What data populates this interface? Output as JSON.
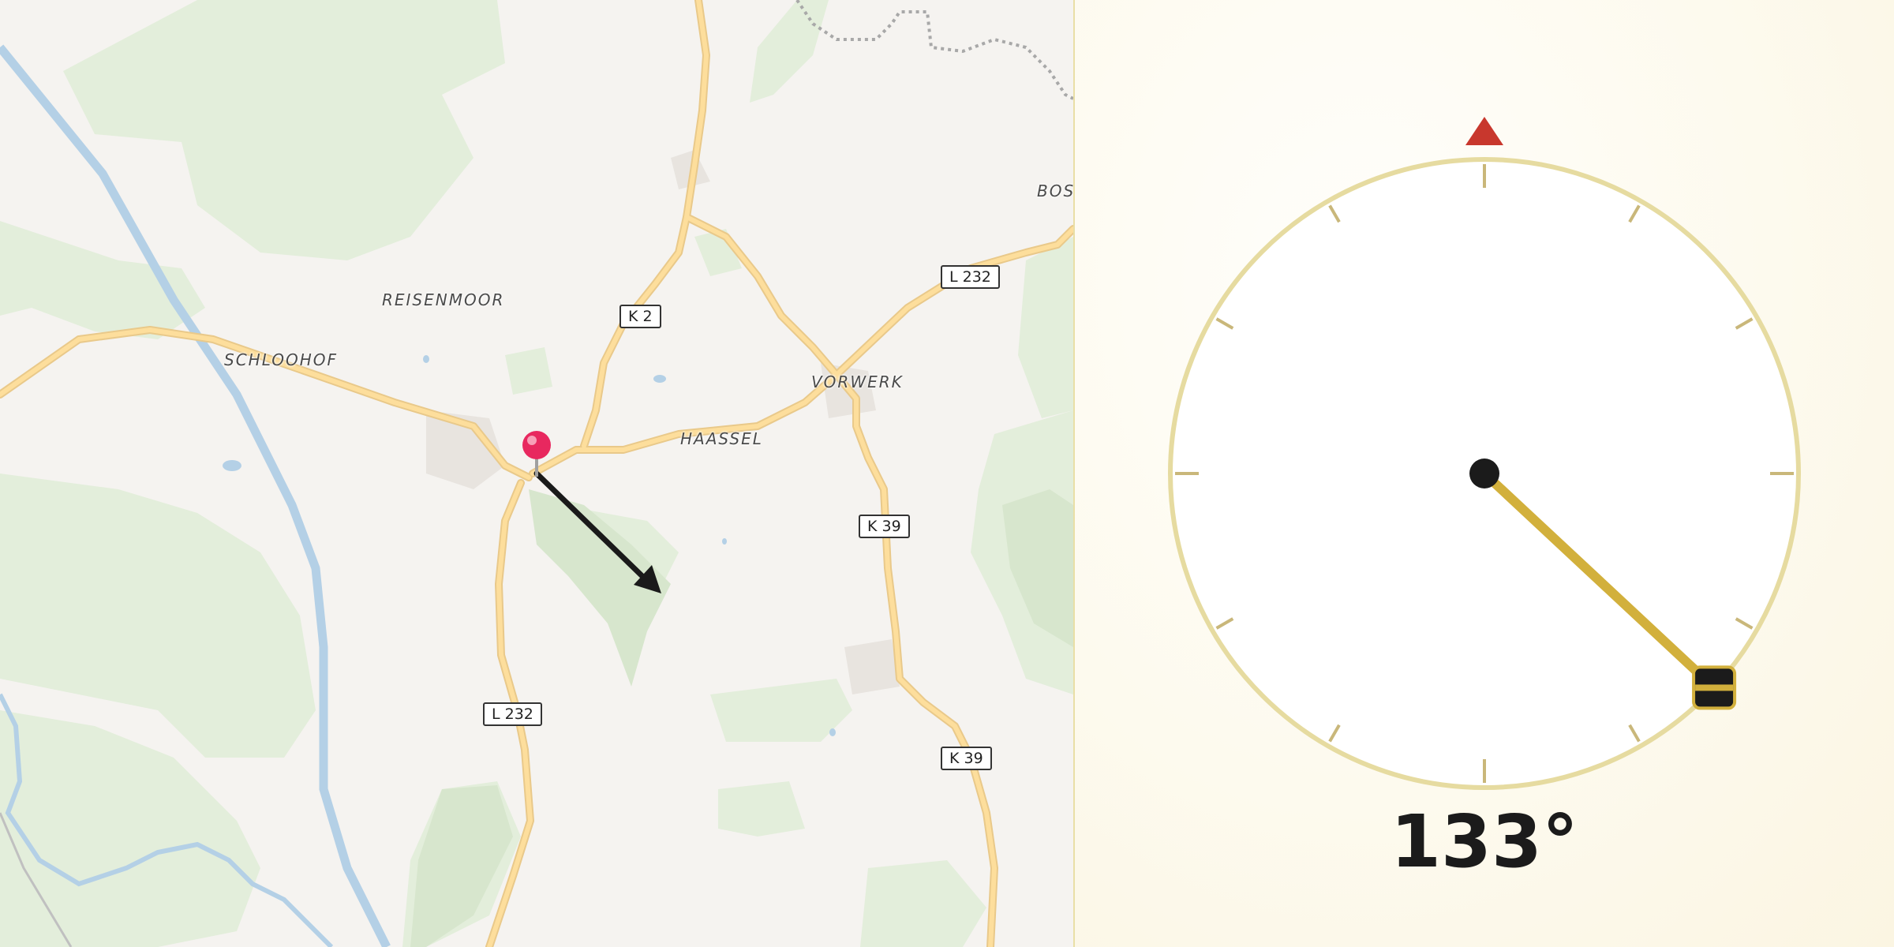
{
  "map": {
    "places": [
      {
        "id": "reisenmoor",
        "label": "REISENMOOR"
      },
      {
        "id": "schloohof",
        "label": "SCHLOOHOF"
      },
      {
        "id": "vorwerk",
        "label": "VORWERK"
      },
      {
        "id": "haassel",
        "label": "HAASSEL"
      },
      {
        "id": "bost",
        "label": "BOST"
      }
    ],
    "roads": [
      {
        "id": "k2",
        "label": "K 2"
      },
      {
        "id": "l232-north",
        "label": "L 232"
      },
      {
        "id": "k39-north",
        "label": "K 39"
      },
      {
        "id": "l232-south",
        "label": "L 232"
      },
      {
        "id": "k39-south",
        "label": "K 39"
      }
    ],
    "pin_color": "#e8285f",
    "arrow_color": "#1a1a1a"
  },
  "compass": {
    "heading_deg": 133,
    "heading_text": "133°",
    "north_marker_color": "#c8372d",
    "needle_color": "#d2b03c",
    "ring_color": "#e6dba0"
  }
}
